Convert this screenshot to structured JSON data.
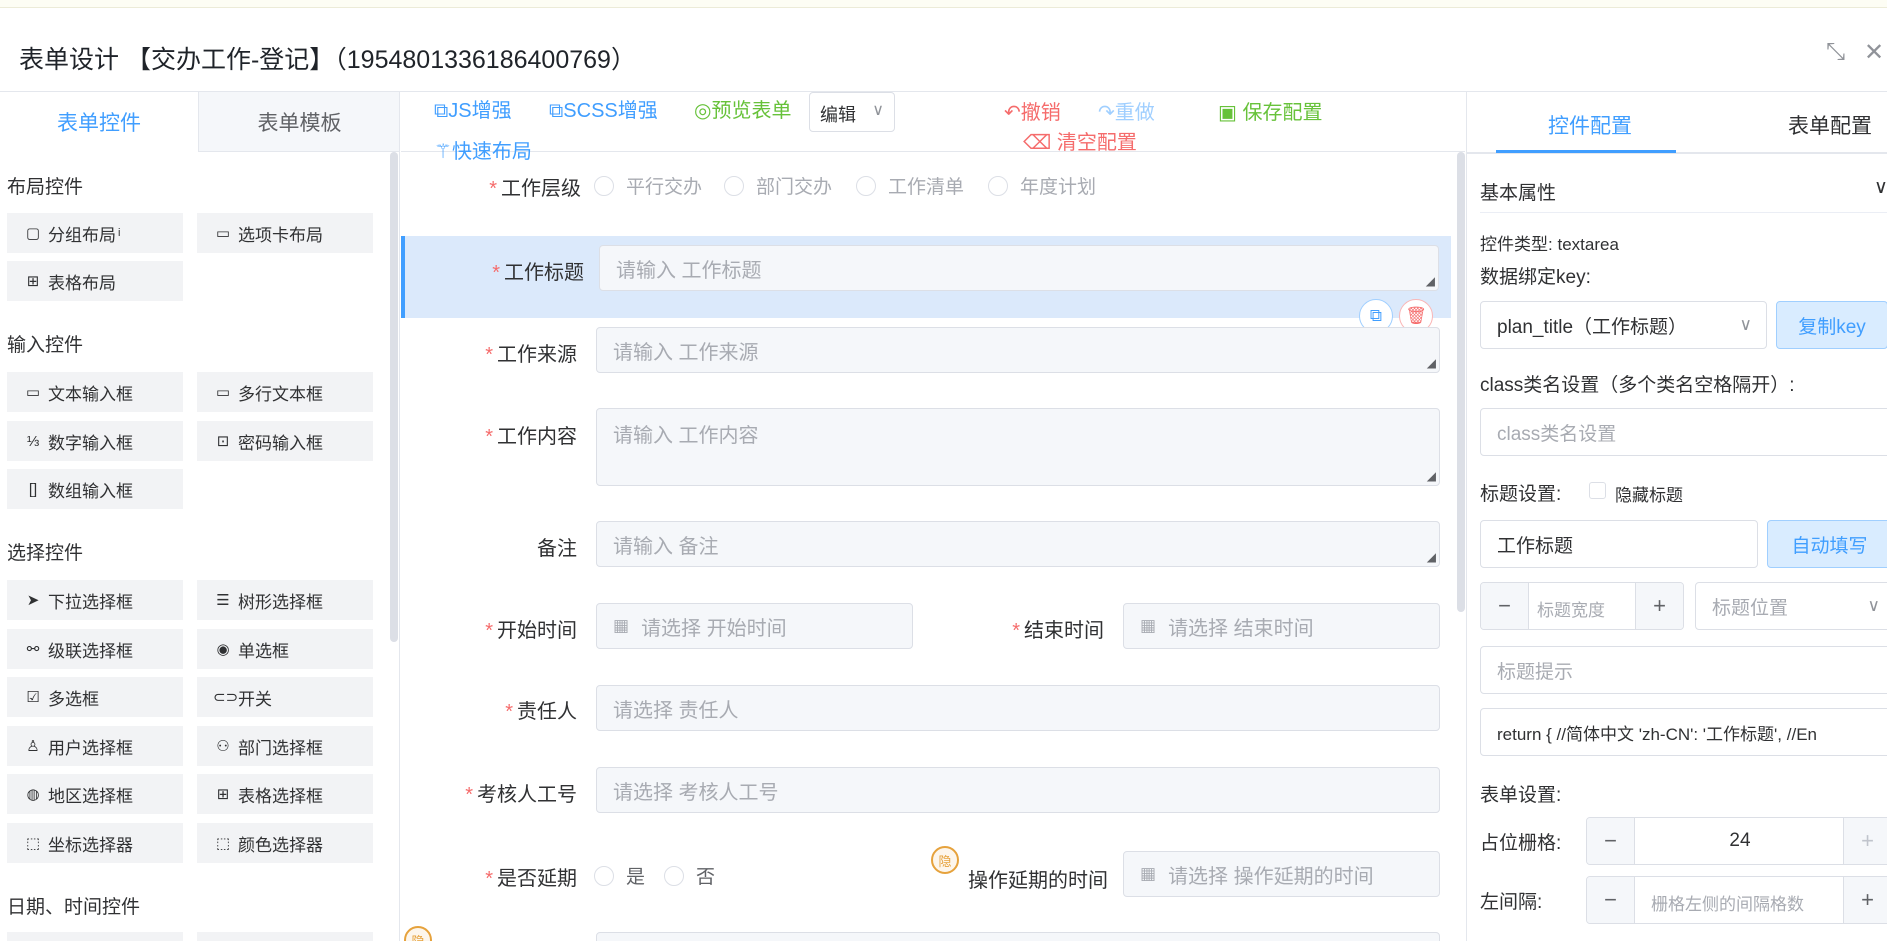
{
  "window": {
    "title": "表单设计 【交办工作-登记】（1954801336186400769）",
    "minimize_glyph": "⤡",
    "close_glyph": "✕"
  },
  "left_panel": {
    "tabs": [
      "表单控件",
      "表单模板"
    ],
    "groups": [
      {
        "title": "布局控件",
        "items": [
          {
            "label": "分组布局",
            "icon": "▢",
            "info": "i"
          },
          {
            "label": "选项卡布局",
            "icon": "▭"
          },
          {
            "label": "表格布局",
            "icon": "⊞"
          }
        ]
      },
      {
        "title": "输入控件",
        "items": [
          {
            "label": "文本输入框",
            "icon": "▭"
          },
          {
            "label": "多行文本框",
            "icon": "▭"
          },
          {
            "label": "数字输入框",
            "icon": "⅓"
          },
          {
            "label": "密码输入框",
            "icon": "⊡"
          },
          {
            "label": "数组输入框",
            "icon": "[]"
          }
        ]
      },
      {
        "title": "选择控件",
        "items": [
          {
            "label": "下拉选择框",
            "icon": "➤"
          },
          {
            "label": "树形选择框",
            "icon": "☰"
          },
          {
            "label": "级联选择框",
            "icon": "⚯"
          },
          {
            "label": "单选框",
            "icon": "◉"
          },
          {
            "label": "多选框",
            "icon": "☑"
          },
          {
            "label": "开关",
            "icon": "⊂⊃"
          },
          {
            "label": "用户选择框",
            "icon": "♙"
          },
          {
            "label": "部门选择框",
            "icon": "⚇"
          },
          {
            "label": "地区选择框",
            "icon": "◍"
          },
          {
            "label": "表格选择框",
            "icon": "⊞"
          },
          {
            "label": "坐标选择器",
            "icon": "⬚"
          },
          {
            "label": "颜色选择器",
            "icon": "⬚"
          }
        ]
      },
      {
        "title": "日期、时间控件",
        "items": []
      }
    ]
  },
  "toolbar": {
    "js": "JS增强",
    "scss": "SCSS增强",
    "preview": "预览表单",
    "mode": "编辑",
    "undo": "撤销",
    "redo": "重做",
    "save": "保存配置",
    "clear": "清空配置",
    "quick_layout": "快速布局"
  },
  "form": {
    "work_level": {
      "label": "工作层级",
      "options": [
        "平行交办",
        "部门交办",
        "工作清单",
        "年度计划"
      ]
    },
    "work_title": {
      "label": "工作标题",
      "placeholder": "请输入 工作标题"
    },
    "work_source": {
      "label": "工作来源",
      "placeholder": "请输入 工作来源"
    },
    "work_content": {
      "label": "工作内容",
      "placeholder": "请输入 工作内容"
    },
    "remark": {
      "label": "备注",
      "placeholder": "请输入 备注"
    },
    "start_time": {
      "label": "开始时间",
      "placeholder": "请选择 开始时间"
    },
    "end_time": {
      "label": "结束时间",
      "placeholder": "请选择 结束时间"
    },
    "owner": {
      "label": "责任人",
      "placeholder": "请选择 责任人"
    },
    "assessor_no": {
      "label": "考核人工号",
      "placeholder": "请选择 考核人工号"
    },
    "is_delayed": {
      "label": "是否延期",
      "options": [
        "是",
        "否"
      ]
    },
    "delay_time": {
      "label": "操作延期的时间",
      "placeholder": "请选择 操作延期的时间",
      "badge": "隐"
    }
  },
  "right_panel": {
    "tabs": [
      "控件配置",
      "表单配置"
    ],
    "section": "基本属性",
    "control_type_label": "控件类型:",
    "control_type_value": "textarea",
    "bind_key_label": "数据绑定key:",
    "bind_key_value": "plan_title（工作标题）",
    "copy_key": "复制key",
    "class_label": "class类名设置（多个类名空格隔开）:",
    "class_placeholder": "class类名设置",
    "title_setting_label": "标题设置:",
    "hide_title": "隐藏标题",
    "title_value": "工作标题",
    "auto_fill": "自动填写",
    "title_width_placeholder": "标题宽度",
    "title_position_placeholder": "标题位置",
    "title_tip_placeholder": "标题提示",
    "i18n_value": "return {  //简体中文  'zh-CN': '工作标题',  //En",
    "form_setting_label": "表单设置:",
    "grid_label": "占位栅格:",
    "grid_value": "24",
    "offset_label": "左间隔:",
    "offset_placeholder": "栅格左侧的间隔格数"
  },
  "colors": {
    "primary": "#409eff",
    "success": "#67c23a",
    "danger": "#f56c6c",
    "selected_bg": "#dbe9fb"
  }
}
